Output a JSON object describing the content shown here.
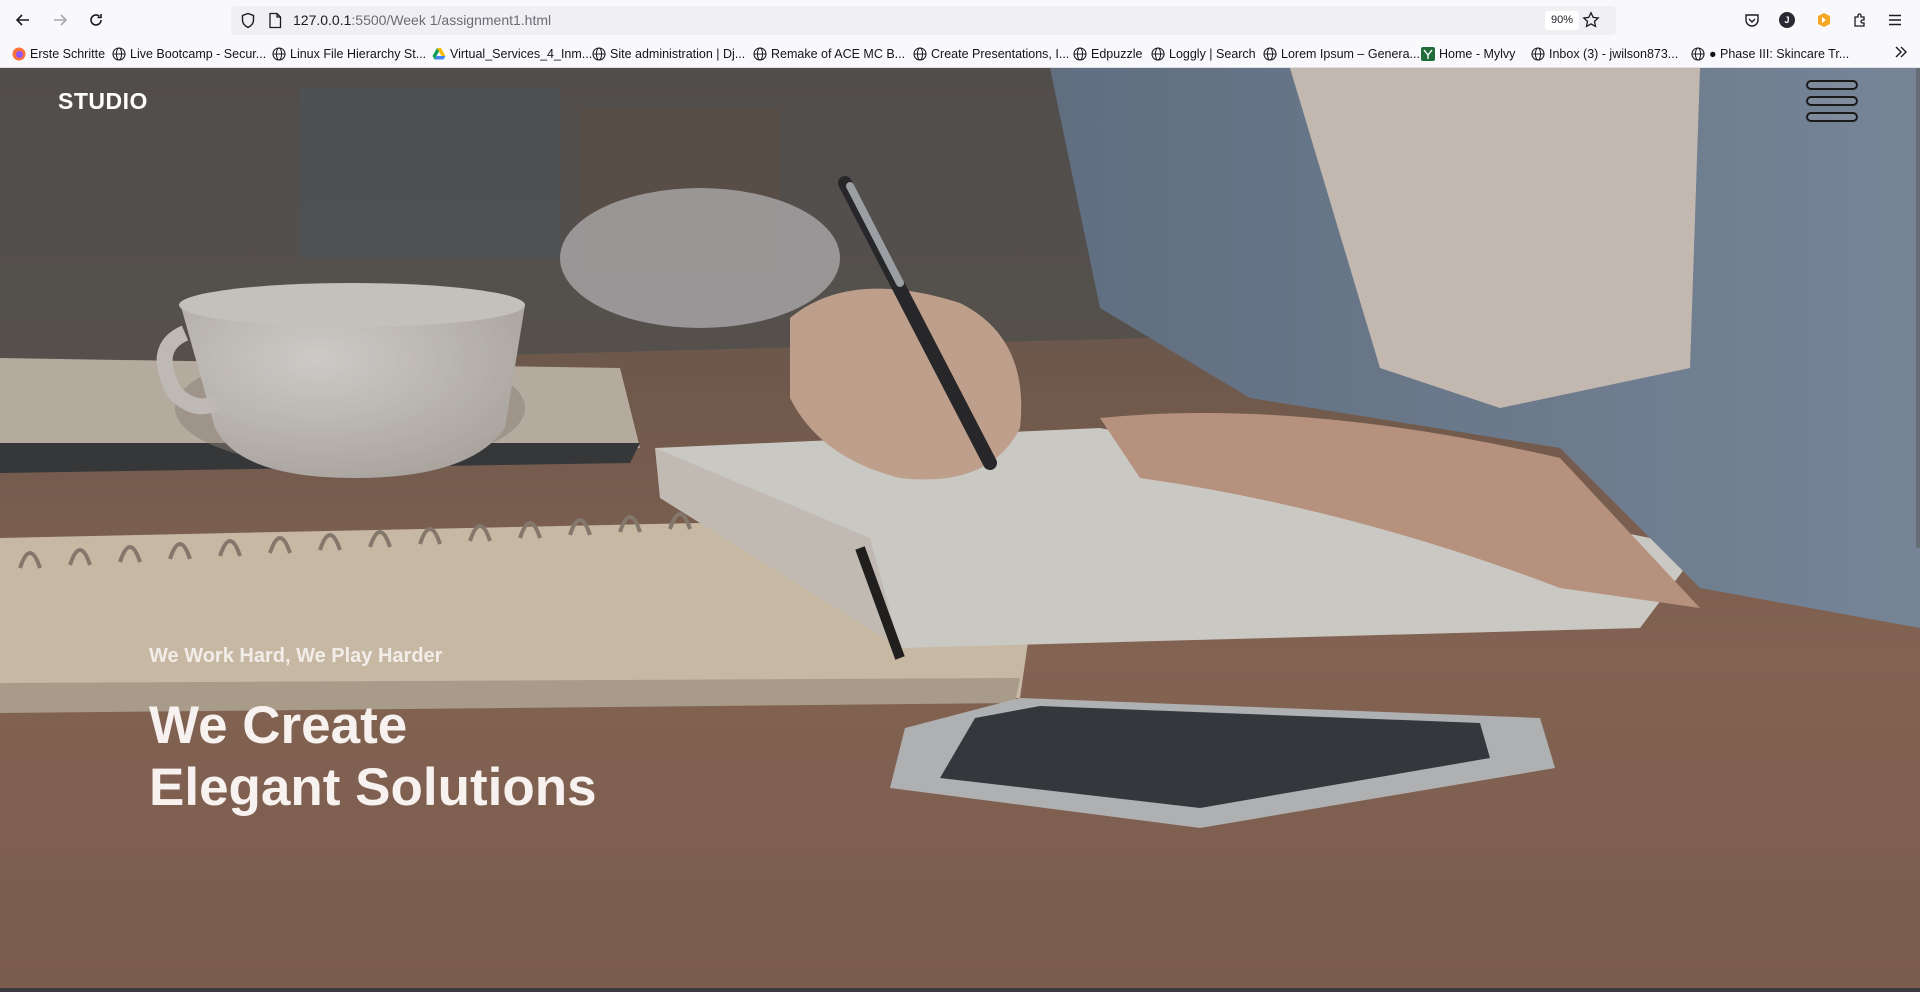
{
  "browser": {
    "url_host": "127.0.0.1",
    "url_rest": ":5500/Week 1/assignment1.html",
    "zoom": "90%",
    "account_initial": "J",
    "bookmarks": [
      {
        "label": "Erste Schritte",
        "icon": "firefox-icon"
      },
      {
        "label": "Live Bootcamp - Secur...",
        "icon": "globe-icon"
      },
      {
        "label": "Linux File Hierarchy St...",
        "icon": "globe-icon"
      },
      {
        "label": "Virtual_Services_4_Inm...",
        "icon": "google-drive-icon"
      },
      {
        "label": "Site administration | Dj...",
        "icon": "globe-icon"
      },
      {
        "label": "Remake of ACE MC B...",
        "icon": "globe-icon"
      },
      {
        "label": "Create Presentations, I...",
        "icon": "globe-icon"
      },
      {
        "label": "Edpuzzle",
        "icon": "globe-icon"
      },
      {
        "label": "Loggly | Search",
        "icon": "globe-icon"
      },
      {
        "label": "Lorem Ipsum – Genera...",
        "icon": "globe-icon"
      },
      {
        "label": "Home - Mylvy",
        "icon": "mylvy-icon"
      },
      {
        "label": "Inbox (3) - jwilson873...",
        "icon": "globe-icon"
      },
      {
        "label": "● Phase III: Skincare Tr...",
        "icon": "globe-icon"
      }
    ]
  },
  "page": {
    "logo": "STUDIO",
    "hero_subtitle": "We Work Hard, We Play Harder",
    "hero_title_line1": "We Create",
    "hero_title_line2": "Elegant Solutions"
  }
}
